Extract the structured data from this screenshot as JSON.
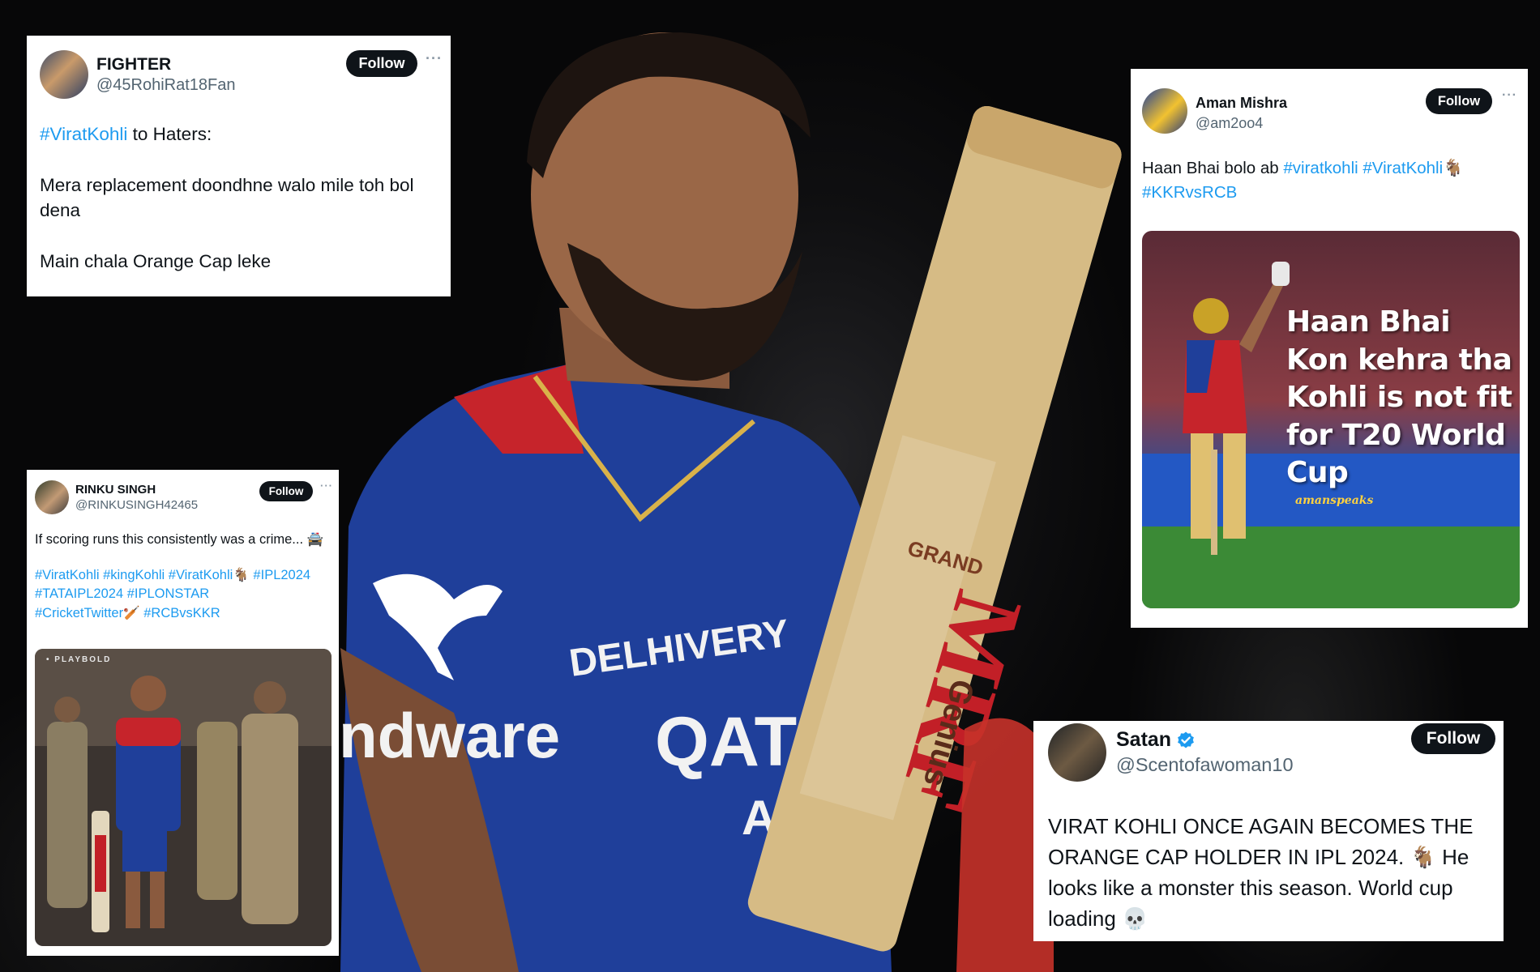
{
  "tweets": [
    {
      "display_name": "FIGHTER",
      "handle": "@45RohiRat18Fan",
      "follow_label": "Follow",
      "more": "···",
      "hashtag": "#ViratKohli",
      "line1_rest": " to Haters:",
      "para2": "Mera replacement doondhne walo mile toh bol dena",
      "para3": "Main chala Orange Cap leke"
    },
    {
      "display_name": "Aman Mishra",
      "handle": "@am2oo4",
      "follow_label": "Follow",
      "more": "···",
      "text_prefix": "Haan Bhai bolo ab ",
      "tags": [
        "#viratkohli",
        "#ViratKohli",
        "#KKRvsRCB"
      ],
      "emoji": "🐐",
      "media_overlay": [
        "Haan Bhai",
        "Kon kehra tha",
        "Kohli is not fit",
        "for T20 World",
        "Cup"
      ],
      "watermark": "amanspeaks"
    },
    {
      "display_name": "RINKU SINGH",
      "handle": "@RINKUSINGH42465",
      "follow_label": "Follow",
      "more": "···",
      "text": "If scoring runs this consistently was a crime... 🚔",
      "tags_line1": "#ViratKohli #kingKohli #ViratKohli",
      "emoji": "🐐",
      "tags_line1b": " #IPL2024",
      "tags_line2": "#TATAIPL2024 #IPLONSTAR",
      "tags_line3": "#CricketTwitter",
      "emoji2": "🏏",
      "tags_line3b": " #RCBvsKKR",
      "media_label": "• PLAYBOLD"
    },
    {
      "display_name": "Satan",
      "handle": "@Scentofawoman10",
      "follow_label": "Follow",
      "text": "VIRAT KOHLI ONCE AGAIN BECOMES THE ORANGE CAP HOLDER IN IPL 2024. 🐐 He looks like a monster this season. World cup loading 💀"
    }
  ],
  "background": {
    "jersey_sponsor": "DELHIVERY",
    "jersey_text_left": "ndware",
    "jersey_text_right": "QAT",
    "jersey_text_right2": "AIR",
    "bat_brand": "MRF",
    "bat_model": "Genius",
    "bat_top": "GRAND"
  },
  "colors": {
    "jersey_blue": "#1f3f9a",
    "jersey_red": "#c6242b",
    "link_blue": "#1d9bf0",
    "bat_wood": "#d6bb85"
  }
}
